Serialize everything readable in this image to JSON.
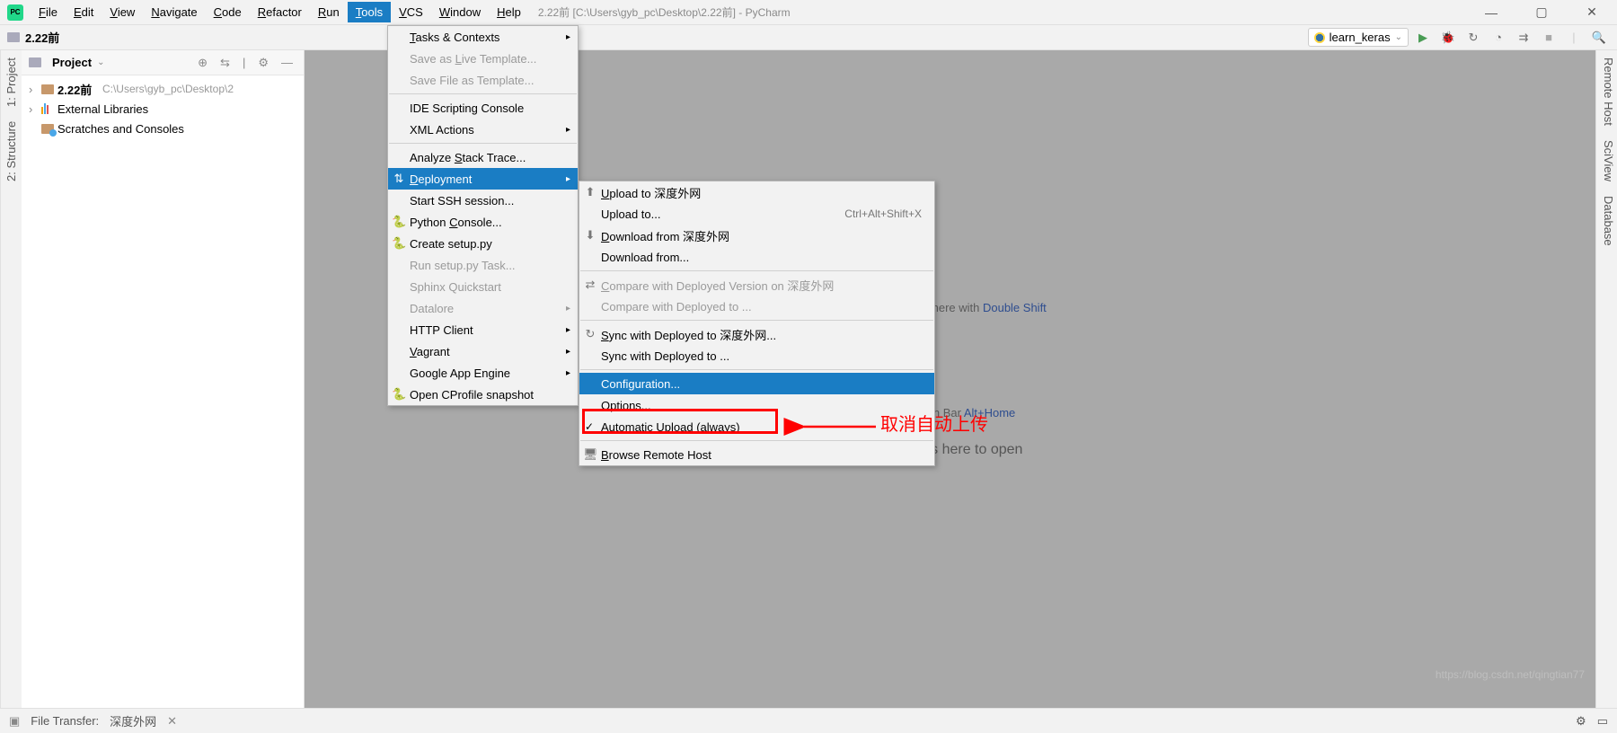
{
  "menubar": {
    "items": [
      "File",
      "Edit",
      "View",
      "Navigate",
      "Code",
      "Refactor",
      "Run",
      "Tools",
      "VCS",
      "Window",
      "Help"
    ],
    "open_index": 7,
    "title": "2.22前 [C:\\Users\\gyb_pc\\Desktop\\2.22前] - PyCharm"
  },
  "navbar": {
    "path": "2.22前",
    "run_config": "learn_keras"
  },
  "project_panel": {
    "title": "Project",
    "root": "2.22前",
    "root_path": "C:\\Users\\gyb_pc\\Desktop\\2",
    "ext_lib": "External Libraries",
    "scratch": "Scratches and Consoles"
  },
  "left_gutter": [
    "2: Structure",
    "1: Project"
  ],
  "right_gutter": [
    "Remote Host",
    "SciView",
    "Database"
  ],
  "editor": {
    "hint1_a": "Search Everywhere with ",
    "hint1_b": "Double Shift",
    "hint2_a": "Navigation Bar ",
    "hint2_b": "Alt+Home",
    "drop": "Drop files here to open"
  },
  "tools_menu": [
    {
      "t": "item",
      "label": "Tasks & Contexts",
      "arrow": true,
      "u": 0
    },
    {
      "t": "item",
      "label": "Save as Live Template...",
      "dis": true,
      "u": 8
    },
    {
      "t": "item",
      "label": "Save File as Template...",
      "dis": true
    },
    {
      "t": "sep"
    },
    {
      "t": "item",
      "label": "IDE Scripting Console"
    },
    {
      "t": "item",
      "label": "XML Actions",
      "arrow": true
    },
    {
      "t": "sep"
    },
    {
      "t": "item",
      "label": "Analyze Stack Trace...",
      "u": 8
    },
    {
      "t": "item",
      "label": "Deployment",
      "arrow": true,
      "sel": true,
      "icon": "deploy",
      "u": 0
    },
    {
      "t": "item",
      "label": "Start SSH session..."
    },
    {
      "t": "item",
      "label": "Python Console...",
      "icon": "py",
      "u": 7
    },
    {
      "t": "item",
      "label": "Create setup.py",
      "icon": "py"
    },
    {
      "t": "item",
      "label": "Run setup.py Task...",
      "dis": true
    },
    {
      "t": "item",
      "label": "Sphinx Quickstart",
      "dis": true
    },
    {
      "t": "item",
      "label": "Datalore",
      "arrow": true,
      "dis": true
    },
    {
      "t": "item",
      "label": "HTTP Client",
      "arrow": true
    },
    {
      "t": "item",
      "label": "Vagrant",
      "arrow": true,
      "u": 0
    },
    {
      "t": "item",
      "label": "Google App Engine",
      "arrow": true
    },
    {
      "t": "item",
      "label": "Open CProfile snapshot",
      "icon": "py"
    }
  ],
  "deploy_menu": [
    {
      "t": "item",
      "label": "Upload to 深度外网",
      "icon": "up",
      "u": 0
    },
    {
      "t": "item",
      "label": "Upload to...",
      "short": "Ctrl+Alt+Shift+X"
    },
    {
      "t": "item",
      "label": "Download from 深度外网",
      "icon": "down",
      "u": 0
    },
    {
      "t": "item",
      "label": "Download from..."
    },
    {
      "t": "sep"
    },
    {
      "t": "item",
      "label": "Compare with Deployed Version on 深度外网",
      "dis": true,
      "icon": "cmp",
      "u": 0
    },
    {
      "t": "item",
      "label": "Compare with Deployed to ...",
      "dis": true
    },
    {
      "t": "sep"
    },
    {
      "t": "item",
      "label": "Sync with Deployed to 深度外网...",
      "icon": "sync",
      "u": 0
    },
    {
      "t": "item",
      "label": "Sync with Deployed to ..."
    },
    {
      "t": "sep"
    },
    {
      "t": "item",
      "label": "Configuration...",
      "sel": true
    },
    {
      "t": "item",
      "label": "Options..."
    },
    {
      "t": "item",
      "label": "Automatic Upload (always)",
      "check": true,
      "u": 0
    },
    {
      "t": "sep"
    },
    {
      "t": "item",
      "label": "Browse Remote Host",
      "icon": "host",
      "u": 0
    }
  ],
  "statusbar": {
    "label": "File Transfer:",
    "server": "深度外网"
  },
  "annotation": {
    "text": "取消自动上传"
  },
  "watermark": "https://blog.csdn.net/qingtian77"
}
